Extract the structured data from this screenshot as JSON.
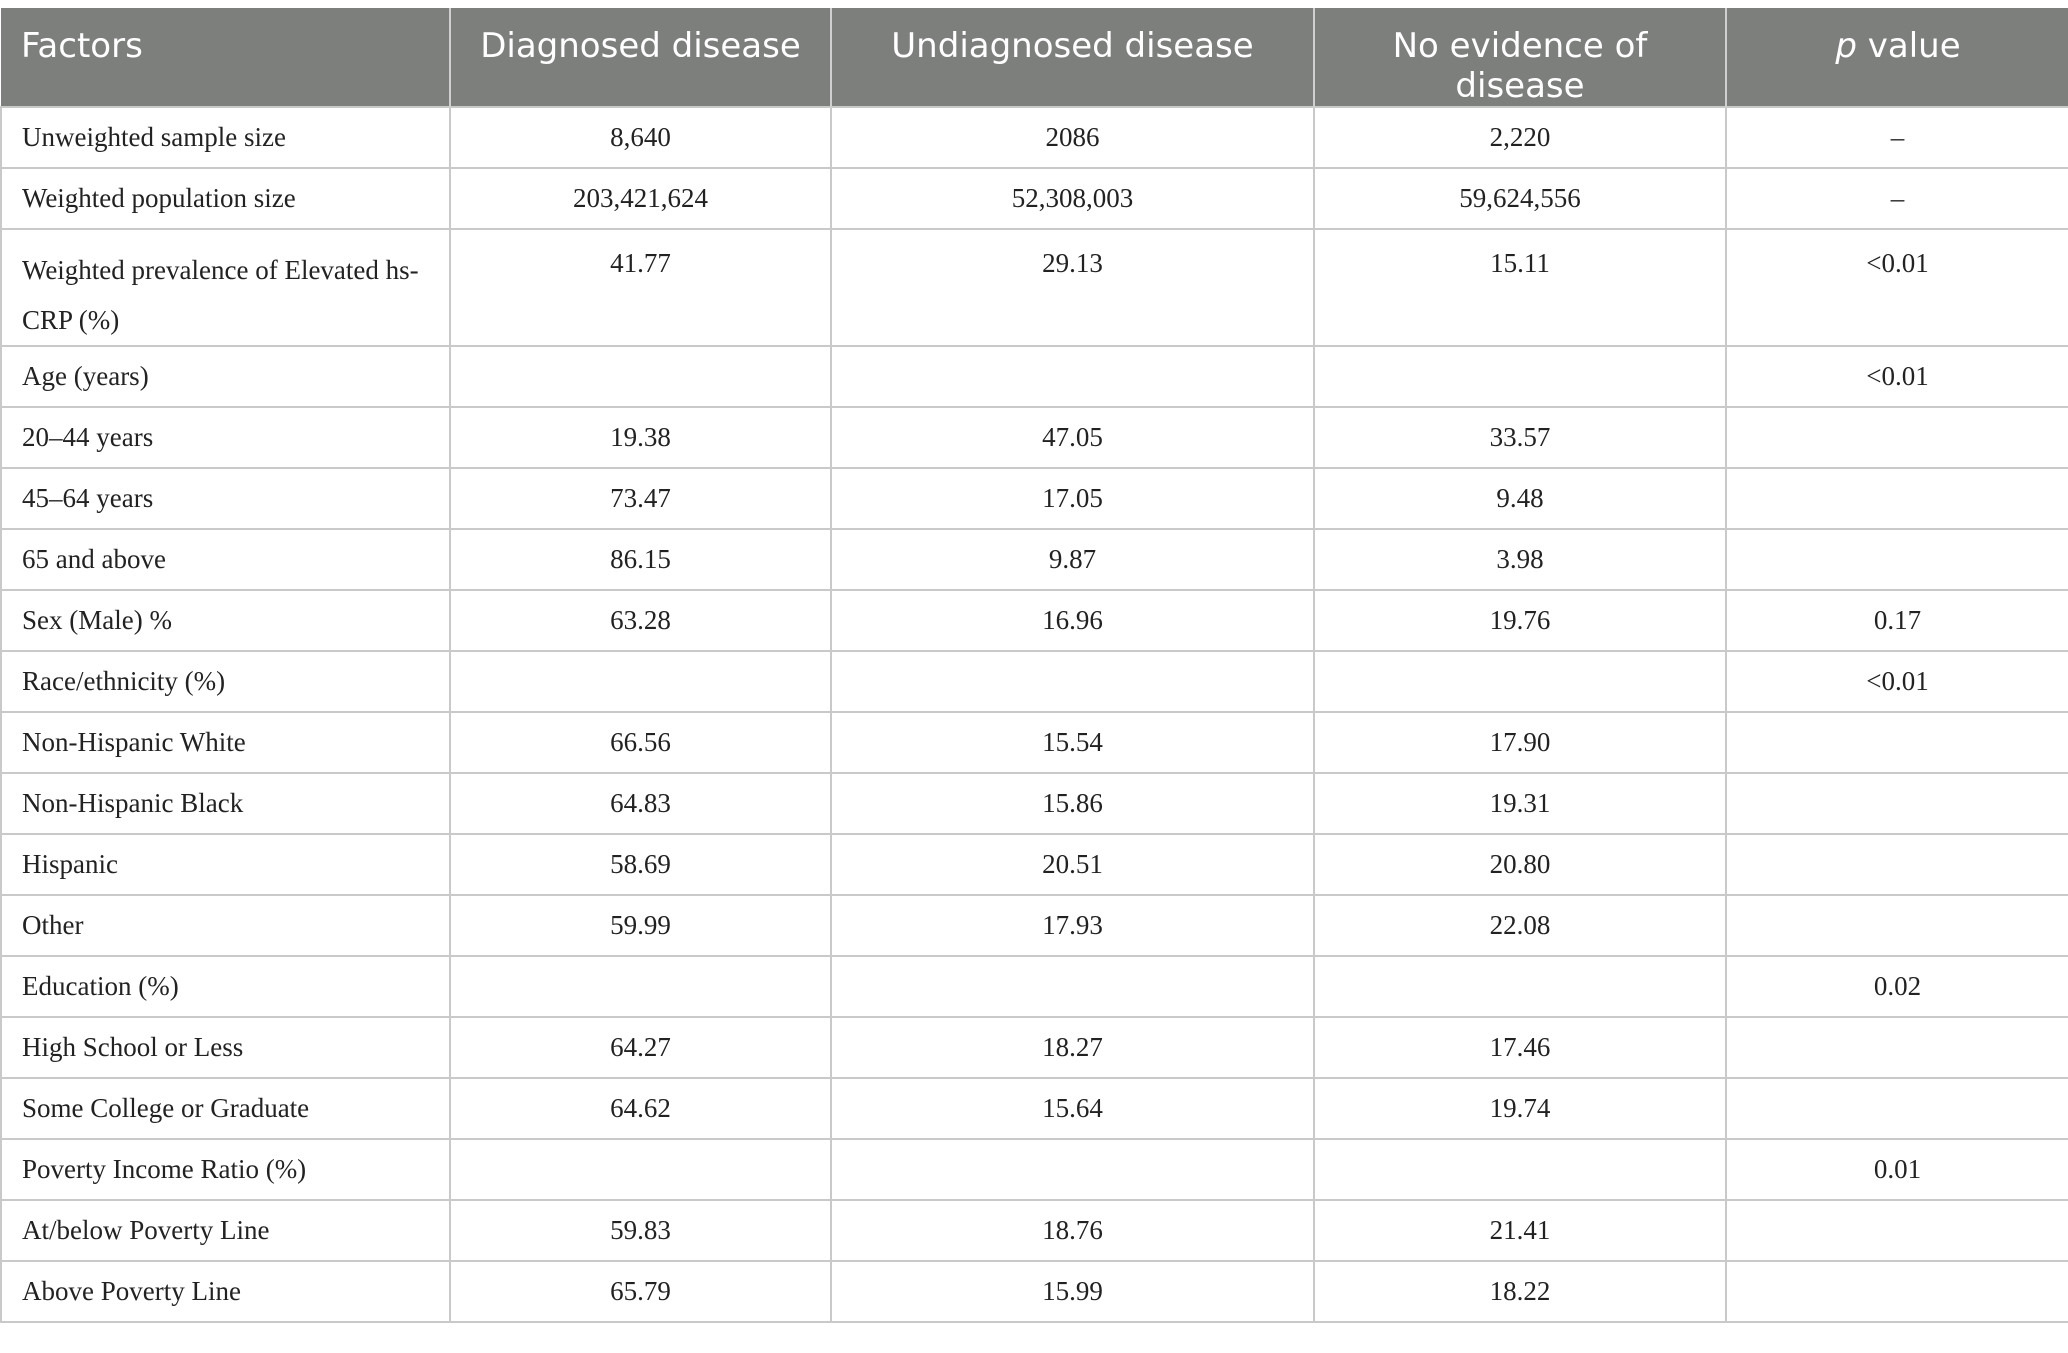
{
  "table": {
    "headers": [
      "Factors",
      "Diagnosed disease",
      "Undiagnosed disease",
      "No evidence of disease",
      "p",
      "value"
    ],
    "rows": [
      [
        "Unweighted sample size",
        "8,640",
        "2086",
        "2,220",
        "–"
      ],
      [
        "Weighted population size",
        "203,421,624",
        "52,308,003",
        "59,624,556",
        "–"
      ],
      [
        "Weighted prevalence of Elevated hs-CRP (%)",
        "41.77",
        "29.13",
        "15.11",
        "<0.01"
      ],
      [
        "Age (years)",
        "",
        "",
        "",
        "<0.01"
      ],
      [
        "20–44 years",
        "19.38",
        "47.05",
        "33.57",
        ""
      ],
      [
        "45–64 years",
        "73.47",
        "17.05",
        "9.48",
        ""
      ],
      [
        "65 and above",
        "86.15",
        "9.87",
        "3.98",
        ""
      ],
      [
        "Sex (Male) %",
        "63.28",
        "16.96",
        "19.76",
        "0.17"
      ],
      [
        "Race/ethnicity (%)",
        "",
        "",
        "",
        "<0.01"
      ],
      [
        "Non-Hispanic White",
        "66.56",
        "15.54",
        "17.90",
        ""
      ],
      [
        "Non-Hispanic Black",
        "64.83",
        "15.86",
        "19.31",
        ""
      ],
      [
        "Hispanic",
        "58.69",
        "20.51",
        "20.80",
        ""
      ],
      [
        "Other",
        "59.99",
        "17.93",
        "22.08",
        ""
      ],
      [
        "Education (%)",
        "",
        "",
        "",
        "0.02"
      ],
      [
        "High School or Less",
        "64.27",
        "18.27",
        "17.46",
        ""
      ],
      [
        "Some College or Graduate",
        "64.62",
        "15.64",
        "19.74",
        ""
      ],
      [
        "Poverty Income Ratio (%)",
        "",
        "",
        "",
        "0.01"
      ],
      [
        "At/below Poverty Line",
        "59.83",
        "18.76",
        "21.41",
        ""
      ],
      [
        "Above Poverty Line",
        "65.79",
        "15.99",
        "18.22",
        ""
      ]
    ]
  }
}
